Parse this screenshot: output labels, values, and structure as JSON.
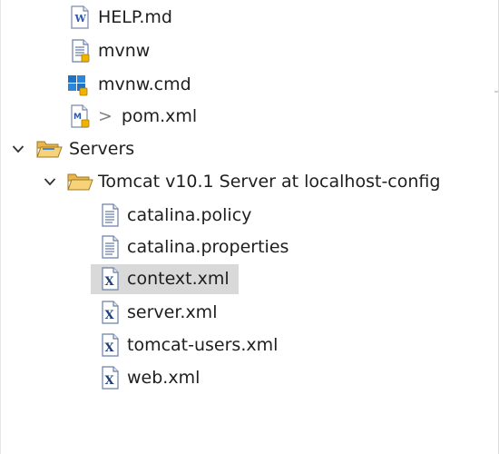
{
  "tree": {
    "items": [
      {
        "label": "HELP.md",
        "icon": "markdown-file-icon"
      },
      {
        "label": "mvnw",
        "icon": "text-file-icon"
      },
      {
        "label": "mvnw.cmd",
        "icon": "cmd-file-icon"
      },
      {
        "label": "pom.xml",
        "decoration": ">",
        "icon": "maven-pom-icon"
      },
      {
        "label": "Servers",
        "icon": "folder-open-icon"
      },
      {
        "label": "Tomcat v10.1 Server at localhost-config",
        "icon": "folder-open-icon"
      },
      {
        "label": "catalina.policy",
        "icon": "text-file-icon"
      },
      {
        "label": "catalina.properties",
        "icon": "text-file-icon"
      },
      {
        "label": "context.xml",
        "icon": "xml-file-icon",
        "selected": true
      },
      {
        "label": "server.xml",
        "icon": "xml-file-icon"
      },
      {
        "label": "tomcat-users.xml",
        "icon": "xml-file-icon"
      },
      {
        "label": "web.xml",
        "icon": "xml-file-icon"
      }
    ]
  },
  "colors": {
    "selection": "#d9d9d9",
    "folder": "#f2c45a",
    "text": "#1e1e1e"
  }
}
